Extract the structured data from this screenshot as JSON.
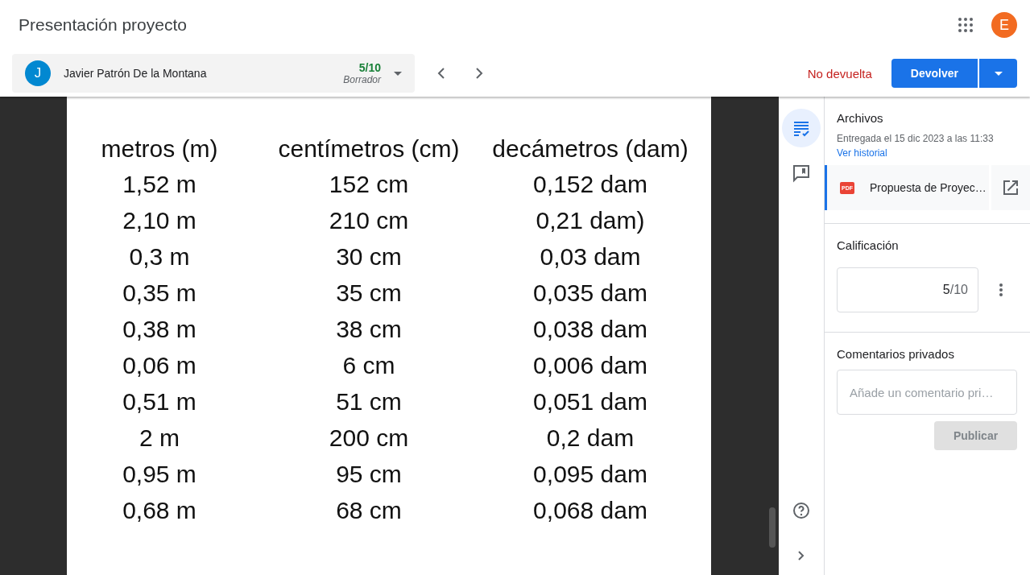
{
  "header": {
    "title": "Presentación proyecto",
    "account_initial": "E"
  },
  "student_bar": {
    "initial": "J",
    "name": "Javier Patrón De la Montana",
    "grade": "5/10",
    "status": "Borrador",
    "status_label": "No devuelta",
    "return_button": "Devolver"
  },
  "document": {
    "columns": [
      "metros (m)",
      "centímetros (cm)",
      "decámetros (dam)"
    ],
    "rows": [
      [
        "1,52 m",
        "152 cm",
        "0,152 dam"
      ],
      [
        "2,10 m",
        "210 cm",
        "0,21 dam)"
      ],
      [
        "0,3 m",
        "30 cm",
        "0,03 dam"
      ],
      [
        "0,35 m",
        "35 cm",
        "0,035 dam"
      ],
      [
        "0,38 m",
        "38 cm",
        "0,038 dam"
      ],
      [
        "0,06 m",
        "6 cm",
        "0,006 dam"
      ],
      [
        "0,51 m",
        "51 cm",
        "0,051 dam"
      ],
      [
        "2 m",
        "200 cm",
        "0,2 dam"
      ],
      [
        "0,95 m",
        "95 cm",
        "0,095 dam"
      ],
      [
        "0,68 m",
        "68 cm",
        "0,068 dam"
      ]
    ]
  },
  "rail": [
    {
      "kind": "details",
      "selected": true
    },
    {
      "kind": "comments",
      "selected": false
    }
  ],
  "files": {
    "title": "Archivos",
    "submitted": "Entregada el 15 dic 2023 a las 11:33",
    "history_link": "Ver historial",
    "items": [
      {
        "name": "Propuesta de Proyec…",
        "badge": "PDF"
      }
    ]
  },
  "grading": {
    "title": "Calificación",
    "score": "5",
    "total": "/10"
  },
  "private_comments": {
    "title": "Comentarios privados",
    "placeholder": "Añade un comentario pri…",
    "post_button": "Publicar",
    "post_disabled": true
  }
}
